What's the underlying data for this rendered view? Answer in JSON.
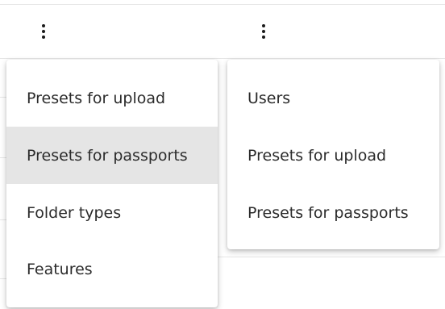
{
  "icons": {
    "left_kebab": "more-vertical-icon",
    "right_kebab": "more-vertical-icon"
  },
  "left_menu": {
    "items": [
      {
        "label": "Presets for upload",
        "highlighted": false
      },
      {
        "label": "Presets for passports",
        "highlighted": true
      },
      {
        "label": "Folder types",
        "highlighted": false
      },
      {
        "label": "Features",
        "highlighted": false
      }
    ]
  },
  "right_menu": {
    "items": [
      {
        "label": "Users"
      },
      {
        "label": "Presets for upload"
      },
      {
        "label": "Presets for passports"
      }
    ]
  },
  "colors": {
    "highlight": "#e5e5e5",
    "text": "#2b2b2b"
  }
}
